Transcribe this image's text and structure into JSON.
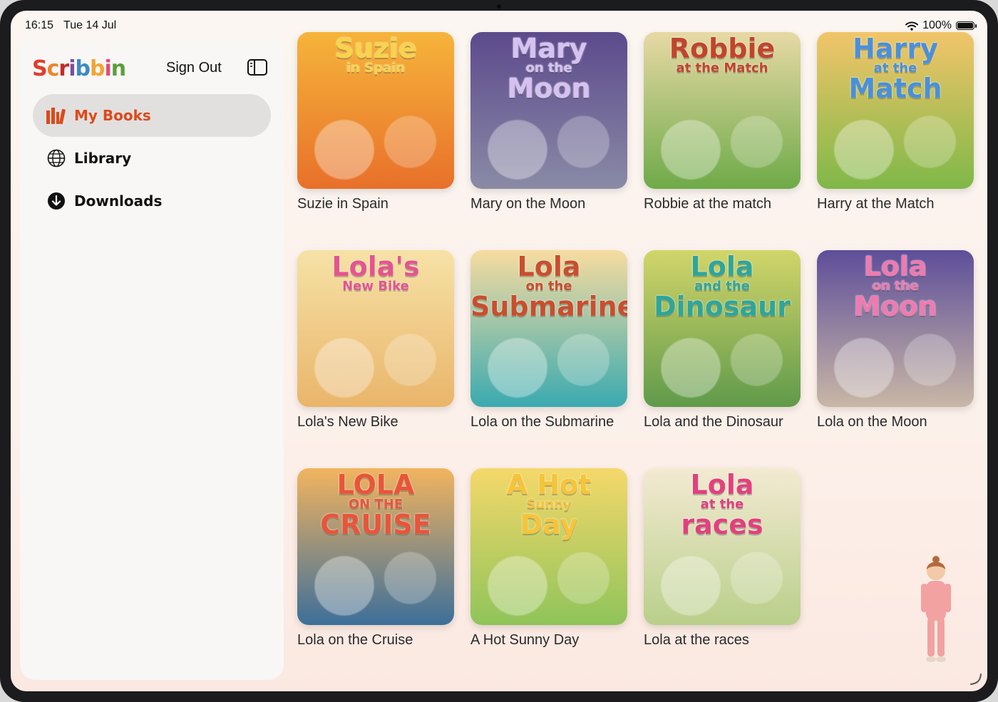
{
  "status": {
    "time": "16:15",
    "date": "Tue 14 Jul",
    "battery": "100%"
  },
  "sidebar": {
    "logo": [
      "S",
      "c",
      "r",
      "i",
      "b",
      "b",
      "i",
      "n"
    ],
    "sign_out": "Sign Out",
    "items": [
      {
        "label": "My Books",
        "icon": "books-icon",
        "active": true
      },
      {
        "label": "Library",
        "icon": "globe-icon",
        "active": false
      },
      {
        "label": "Downloads",
        "icon": "download-icon",
        "active": false
      }
    ]
  },
  "books": [
    {
      "title": "Suzie in Spain",
      "cover": {
        "l1": "Suzie",
        "l2": "in Spain",
        "l3": ""
      },
      "colors": [
        "#f6b43a",
        "#e8702a"
      ],
      "ink": "#f7d44a"
    },
    {
      "title": "Mary on the Moon",
      "cover": {
        "l1": "Mary",
        "l2": "on the",
        "l3": "Moon"
      },
      "colors": [
        "#5c4a8c",
        "#8a8aa6"
      ],
      "ink": "#d6c2f2"
    },
    {
      "title": "Robbie at the match",
      "cover": {
        "l1": "Robbie",
        "l2": "at the Match",
        "l3": ""
      },
      "colors": [
        "#e7d9a5",
        "#6eaa48"
      ],
      "ink": "#c2442a"
    },
    {
      "title": "Harry at the Match",
      "cover": {
        "l1": "Harry",
        "l2": "at the",
        "l3": "Match"
      },
      "colors": [
        "#f2c56a",
        "#7fb848"
      ],
      "ink": "#4a90d9"
    },
    {
      "title": "Lola's New Bike",
      "cover": {
        "l1": "Lola's",
        "l2": "New Bike",
        "l3": ""
      },
      "colors": [
        "#f6e2a6",
        "#e9b56a"
      ],
      "ink": "#e5548f"
    },
    {
      "title": "Lola on the Submarine",
      "cover": {
        "l1": "Lola",
        "l2": "on the",
        "l3": "Submarine"
      },
      "colors": [
        "#f7dca0",
        "#3aaab0"
      ],
      "ink": "#c94e2e"
    },
    {
      "title": "Lola and the Dinosaur",
      "cover": {
        "l1": "Lola",
        "l2": "and the",
        "l3": "Dinosaur"
      },
      "colors": [
        "#d2d56a",
        "#5f9a4a"
      ],
      "ink": "#2fa59a"
    },
    {
      "title": "Lola on the Moon",
      "cover": {
        "l1": "Lola",
        "l2": "on the",
        "l3": "Moon"
      },
      "colors": [
        "#5d4e9a",
        "#c9b7a6"
      ],
      "ink": "#f07ab0"
    },
    {
      "title": "Lola on the Cruise",
      "cover": {
        "l1": "LOLA",
        "l2": "ON THE",
        "l3": "CRUISE"
      },
      "colors": [
        "#f2b45e",
        "#3d6f9a"
      ],
      "ink": "#e8553a"
    },
    {
      "title": "A Hot Sunny Day",
      "cover": {
        "l1": "A Hot",
        "l2": "Sunny",
        "l3": "Day"
      },
      "colors": [
        "#f5d86a",
        "#8fc45a"
      ],
      "ink": "#f6c43a"
    },
    {
      "title": "Lola at the races",
      "cover": {
        "l1": "Lola",
        "l2": "at the",
        "l3": "races"
      },
      "colors": [
        "#f3ead2",
        "#b9cf8a"
      ],
      "ink": "#e2407e"
    }
  ]
}
